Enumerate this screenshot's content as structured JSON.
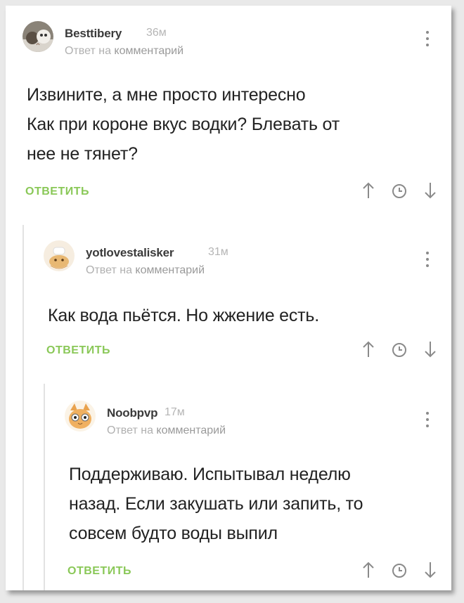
{
  "comments": [
    {
      "author": "Besttibery",
      "time": "36м",
      "reply_prefix": "Ответ на",
      "reply_link": "комментарий",
      "lines": [
        "Извините, а мне просто интересно",
        "Как при короне вкус водки? Блевать от",
        "нее не тянет?"
      ],
      "reply_label": "ОТВЕТИТЬ"
    },
    {
      "author": "yotlovestalisker",
      "time": "31м",
      "reply_prefix": "Ответ на",
      "reply_link": "комментарий",
      "lines": [
        "Как вода пьётся. Но жжение есть."
      ],
      "reply_label": "ОТВЕТИТЬ"
    },
    {
      "author": "Noobpvp",
      "time": "17м",
      "reply_prefix": "Ответ на",
      "reply_link": "комментарий",
      "lines": [
        "Поддерживаю. Испытывал неделю",
        "назад. Если закушать или запить, то",
        "совсем будто воды выпил"
      ],
      "reply_label": "ОТВЕТИТЬ"
    }
  ],
  "icons": {
    "upvote": "arrow-up-icon",
    "history": "clock-icon",
    "downvote": "arrow-down-icon",
    "menu": "kebab-menu-icon"
  },
  "colors": {
    "reply_green": "#8ac858",
    "icon_gray": "#8a8a8a",
    "thread_line": "#e2e2e2"
  }
}
